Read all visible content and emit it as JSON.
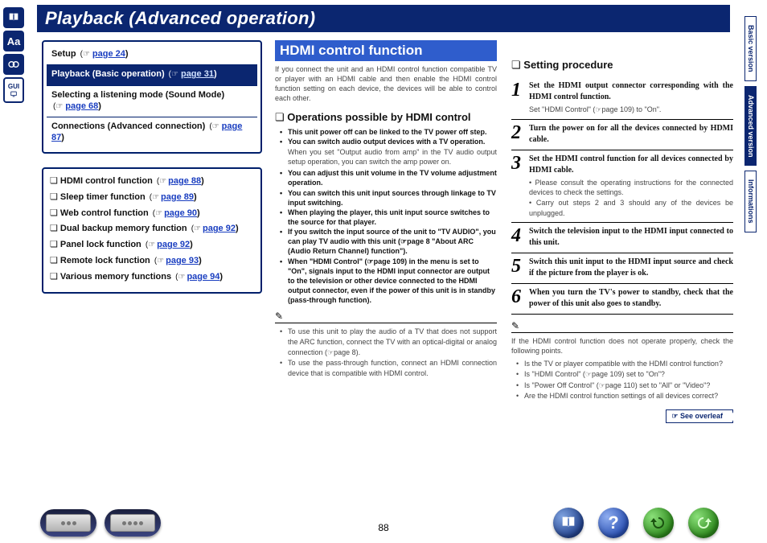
{
  "title": "Playback (Advanced operation)",
  "page_number": "88",
  "side_tabs": {
    "basic": "Basic version",
    "advanced": "Advanced version",
    "info": "Informations"
  },
  "nav": {
    "setup": {
      "label": "Setup",
      "page": "page 24"
    },
    "basic": {
      "label": "Playback (Basic operation)",
      "page": "page 31"
    },
    "sound": {
      "label": "Selecting a listening mode (Sound Mode)",
      "page": "page 68"
    },
    "conn": {
      "label": "Connections (Advanced connection)",
      "page": "page 87"
    }
  },
  "features": [
    {
      "label": "HDMI control function",
      "page": "page 88"
    },
    {
      "label": "Sleep timer function",
      "page": "page 89"
    },
    {
      "label": "Web control function",
      "page": "page 90"
    },
    {
      "label": "Dual backup memory function",
      "page": "page 92"
    },
    {
      "label": "Panel lock function",
      "page": "page 92"
    },
    {
      "label": "Remote lock function",
      "page": "page 93"
    },
    {
      "label": "Various memory functions",
      "page": "page 94"
    }
  ],
  "hdmi": {
    "heading": "HDMI control function",
    "intro": "If you connect the unit and an HDMI control function compatible TV or player with an HDMI cable and then enable the HDMI control function setting on each device, the devices will be able to control each other.",
    "ops_head": "Operations possible by HDMI control",
    "ops": [
      {
        "b": "This unit power off can be linked to the TV power off step."
      },
      {
        "b": "You can switch audio output devices with a TV operation.",
        "n": "When you set \"Output audio from amp\" in the TV audio output setup operation, you can switch the amp power on."
      },
      {
        "b": "You can adjust this unit volume in the TV volume adjustment operation."
      },
      {
        "b": "You can switch this unit input sources through linkage to TV input switching."
      },
      {
        "b": "When playing the player, this unit input source switches to the source for that player."
      },
      {
        "b": "If you switch the input source of the unit to \"TV AUDIO\", you can play TV audio with this unit (☞page 8 \"About ARC (Audio Return Channel) function\")."
      },
      {
        "b": "When \"HDMI Control\" (☞page 109) in the menu is set to \"On\", signals input to the HDMI input connector are output to the television or other device connected to the HDMI output connector, even if the power of this unit is in standby (pass-through function)."
      }
    ],
    "tips": [
      "To use this unit to play the audio of a TV that does not support the ARC function, connect the TV with an optical-digital or analog connection (☞page 8).",
      "To use the pass-through function, connect an HDMI connection device that is compatible with HDMI control."
    ]
  },
  "setting": {
    "heading": "Setting procedure",
    "steps": [
      {
        "n": "1",
        "t": "Set the HDMI output connector corresponding with the HDMI control function.",
        "s": "Set \"HDMI Control\" (☞page 109) to \"On\"."
      },
      {
        "n": "2",
        "t": "Turn the power on for all the devices connected by HDMI cable."
      },
      {
        "n": "3",
        "t": "Set the HDMI control function for all devices connected by HDMI cable.",
        "s": "• Please consult the operating instructions for the connected devices to check the settings.\n• Carry out steps 2 and 3 should any of the devices be unplugged.",
        "multi": true
      },
      {
        "n": "4",
        "t": "Switch the television input to the HDMI input connected to this unit."
      },
      {
        "n": "5",
        "t": "Switch this unit input to the HDMI input source and check if the picture from the player is ok."
      },
      {
        "n": "6",
        "t": "When you turn the TV's power to standby, check that the power of this unit also goes to standby."
      }
    ],
    "troubleshoot_intro": "If the HDMI control function does not operate properly, check the following points.",
    "troubleshoot": [
      "Is the TV or player compatible with the HDMI control function?",
      "Is \"HDMI Control\" (☞page 109) set to \"On\"?",
      "Is \"Power Off Control\" (☞page 110) set to \"All\" or \"Video\"?",
      "Are the HDMI control function settings of all devices correct?"
    ],
    "overleaf": "See overleaf"
  }
}
